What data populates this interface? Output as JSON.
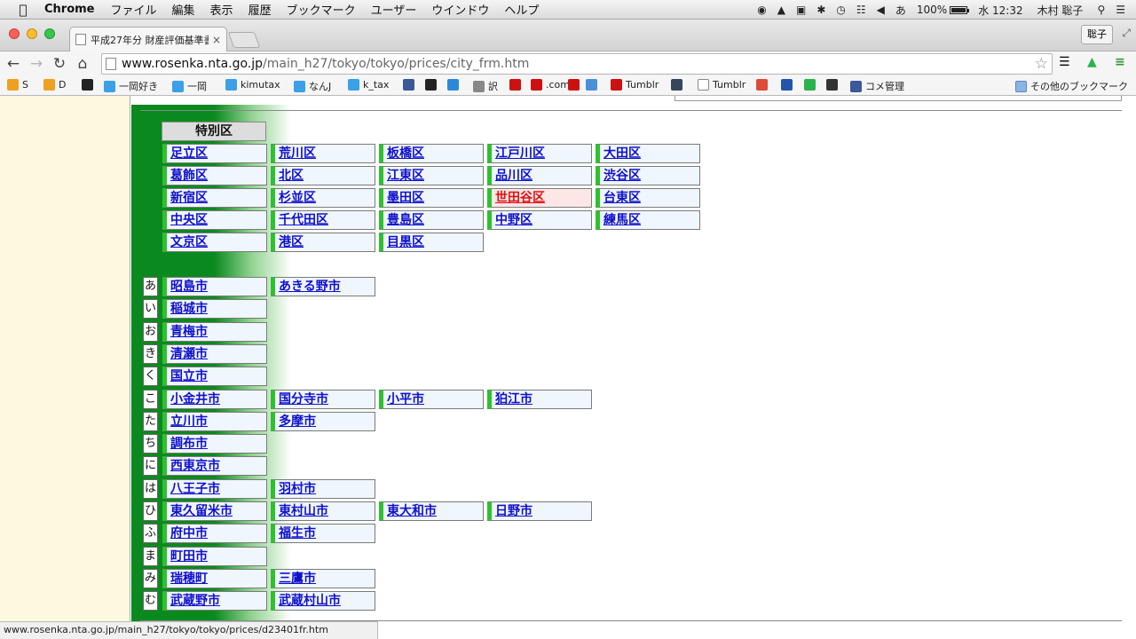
{
  "menubar": {
    "app_name": "Chrome",
    "menus": [
      "ファイル",
      "編集",
      "表示",
      "履歴",
      "ブックマーク",
      "ユーザー",
      "ウインドウ",
      "ヘルプ"
    ],
    "ime": "あ",
    "battery": "100%",
    "clock": "水 12:32",
    "user": "木村 聡子"
  },
  "tab": {
    "title": "平成27年分 財産評価基準書",
    "close": "×"
  },
  "profile_label": "聡子",
  "toolbar": {
    "url_host": "www.rosenka.nta.go.jp",
    "url_path": "/main_h27/tokyo/tokyo/prices/city_frm.htm"
  },
  "bookmarks": [
    {
      "label": "S",
      "icon": "checkbox-icon",
      "color": "#f0a020"
    },
    {
      "label": "D",
      "icon": "checkbox-icon",
      "color": "#f0a020"
    },
    {
      "label": "",
      "icon": "shield-icon",
      "color": "#222222"
    },
    {
      "label": "一岡好き",
      "icon": "twitter-icon",
      "color": "#3aa0e8"
    },
    {
      "label": "一岡",
      "icon": "twitter-icon",
      "color": "#3aa0e8"
    },
    {
      "label": "kimutax",
      "icon": "twitter-icon",
      "color": "#3aa0e8"
    },
    {
      "label": "なんJ",
      "icon": "twitter-icon",
      "color": "#3aa0e8"
    },
    {
      "label": "k_tax",
      "icon": "twitter-icon",
      "color": "#3aa0e8"
    },
    {
      "label": "",
      "icon": "facebook-icon",
      "color": "#3b5998"
    },
    {
      "label": "",
      "icon": "stack-icon",
      "color": "#222222"
    },
    {
      "label": "",
      "icon": "calendar-icon",
      "color": "#2a8ad8"
    },
    {
      "label": "訳",
      "icon": "translate-icon",
      "color": "#888888"
    },
    {
      "label": "",
      "icon": "bookmark-red-icon",
      "color": "#cc1111"
    },
    {
      "label": ".com",
      "icon": "bookmark-red-icon",
      "color": "#cc1111"
    },
    {
      "label": "",
      "icon": "bookmark-red-icon",
      "color": "#cc1111"
    },
    {
      "label": "",
      "icon": "pencil-icon",
      "color": "#4a90d9"
    },
    {
      "label": "Tumblr",
      "icon": "bookmark-red-icon",
      "color": "#cc1111"
    },
    {
      "label": "",
      "icon": "tumblr-icon",
      "color": "#35465c"
    },
    {
      "label": "Tumblr",
      "icon": "page-icon",
      "color": "#ffffff"
    },
    {
      "label": "",
      "icon": "googleplus-icon",
      "color": "#dd4b39"
    },
    {
      "label": "",
      "icon": "org-icon",
      "color": "#2255aa"
    },
    {
      "label": "",
      "icon": "feedly-icon",
      "color": "#2bb24c"
    },
    {
      "label": "",
      "icon": "film-icon",
      "color": "#333333"
    },
    {
      "label": "コメ管理",
      "icon": "facebook-icon",
      "color": "#3b5998"
    }
  ],
  "other_bookmarks": "その他のブックマーク",
  "special_wards": {
    "header": "特別区",
    "rows": [
      [
        "足立区",
        "荒川区",
        "板橋区",
        "江戸川区",
        "大田区"
      ],
      [
        "葛飾区",
        "北区",
        "江東区",
        "品川区",
        "渋谷区"
      ],
      [
        "新宿区",
        "杉並区",
        "墨田区",
        "世田谷区",
        "台東区"
      ],
      [
        "中央区",
        "千代田区",
        "豊島区",
        "中野区",
        "練馬区"
      ],
      [
        "文京区",
        "港区",
        "目黒区"
      ]
    ],
    "active": "世田谷区"
  },
  "cities": [
    {
      "kana": "あ",
      "items": [
        "昭島市",
        "あきる野市"
      ]
    },
    {
      "kana": "い",
      "items": [
        "稲城市"
      ]
    },
    {
      "kana": "お",
      "items": [
        "青梅市"
      ]
    },
    {
      "kana": "き",
      "items": [
        "清瀬市"
      ]
    },
    {
      "kana": "く",
      "items": [
        "国立市"
      ]
    },
    {
      "kana": "こ",
      "items": [
        "小金井市",
        "国分寺市",
        "小平市",
        "狛江市"
      ]
    },
    {
      "kana": "た",
      "items": [
        "立川市",
        "多摩市"
      ]
    },
    {
      "kana": "ち",
      "items": [
        "調布市"
      ]
    },
    {
      "kana": "に",
      "items": [
        "西東京市"
      ]
    },
    {
      "kana": "は",
      "items": [
        "八王子市",
        "羽村市"
      ]
    },
    {
      "kana": "ひ",
      "items": [
        "東久留米市",
        "東村山市",
        "東大和市",
        "日野市"
      ]
    },
    {
      "kana": "ふ",
      "items": [
        "府中市",
        "福生市"
      ]
    },
    {
      "kana": "ま",
      "items": [
        "町田市"
      ]
    },
    {
      "kana": "み",
      "items": [
        "瑞穂町",
        "三鷹市"
      ]
    },
    {
      "kana": "む",
      "items": [
        "武蔵野市",
        "武蔵村山市"
      ]
    }
  ],
  "status_url": "www.rosenka.nta.go.jp/main_h27/tokyo/tokyo/prices/d23401fr.htm",
  "colors": {
    "link": "#1010cc",
    "active_link": "#e01010",
    "cell_bg": "#eff6fd",
    "active_bg": "#fde6e6",
    "cell_marker": "#2ec12e",
    "green_band": "#0a8a1e",
    "left_pane": "#fdf8e0"
  }
}
